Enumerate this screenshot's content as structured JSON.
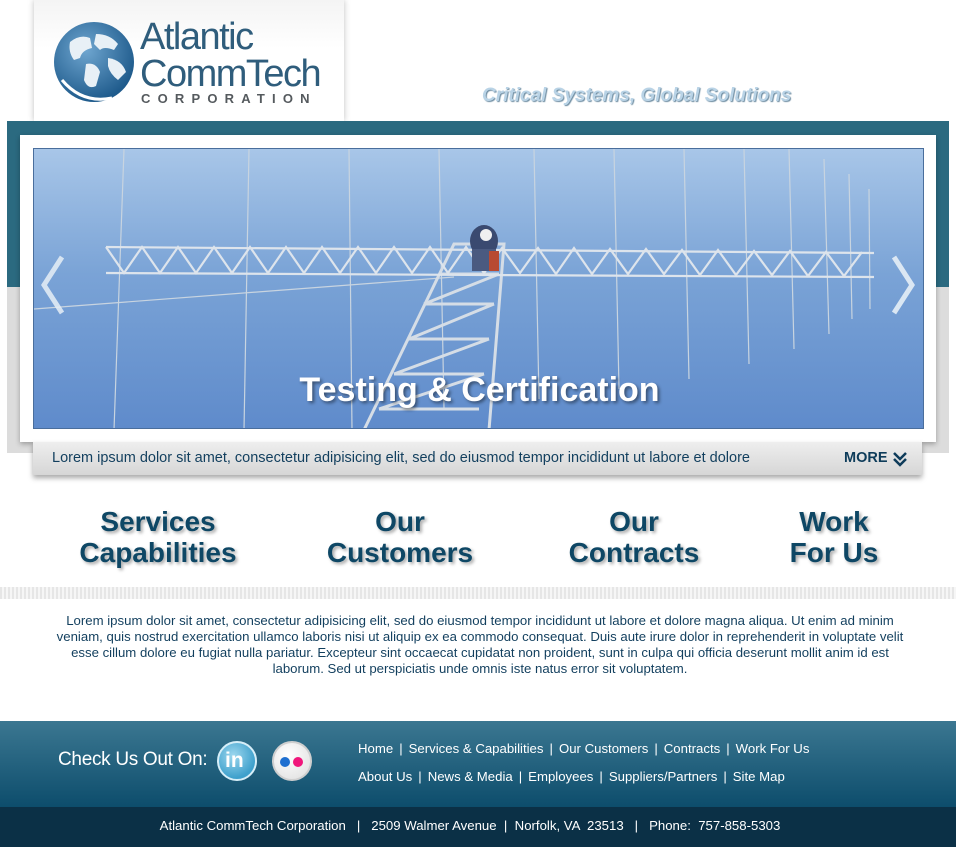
{
  "header": {
    "logo_line1": "Atlantic",
    "logo_line2": "CommTech",
    "logo_corp": "CORPORATION",
    "tagline": "Critical Systems, Global Solutions"
  },
  "slider": {
    "caption": "Testing & Certification",
    "summary": "Lorem ipsum dolor sit amet, consectetur adipisicing elit, sed do eiusmod tempor incididunt ut labore et dolore",
    "more_label": "MORE"
  },
  "features": [
    {
      "line1": "Services",
      "line2": "Capabilities"
    },
    {
      "line1": "Our",
      "line2": "Customers"
    },
    {
      "line1": "Our",
      "line2": "Contracts"
    },
    {
      "line1": "Work",
      "line2": "For Us"
    }
  ],
  "body_text": "Lorem ipsum dolor sit amet, consectetur adipisicing elit, sed do eiusmod tempor incididunt ut labore et dolore magna aliqua. Ut enim ad minim veniam, quis nostrud exercitation ullamco laboris nisi ut aliquip ex ea commodo consequat. Duis aute irure dolor in reprehenderit in voluptate velit esse cillum dolore eu fugiat nulla pariatur. Excepteur sint occaecat cupidatat non proident, sunt in culpa qui officia deserunt mollit anim id est laborum. Sed ut perspiciatis unde omnis iste natus error sit voluptatem.",
  "footer": {
    "check_label": "Check Us Out On:",
    "linkedin_label": "in",
    "nav_row1": [
      "Home",
      "Services & Capabilities",
      "Our Customers",
      "Contracts",
      "Work For Us"
    ],
    "nav_row2": [
      "About Us",
      "News & Media",
      "Employees",
      "Suppliers/Partners",
      "Site Map"
    ],
    "separator": "|",
    "address": "Atlantic CommTech Corporation   |   2509 Walmer Avenue  |  Norfolk, VA  23513   |   Phone:  757-858-5303"
  },
  "colors": {
    "brand_teal": "#2b6a80",
    "brand_navy": "#0b3046",
    "heading_blue": "#0e4765"
  },
  "icons": [
    "globe-logo-icon",
    "arrow-left-icon",
    "arrow-right-icon",
    "double-chevron-down-icon",
    "linkedin-icon",
    "flickr-icon"
  ]
}
